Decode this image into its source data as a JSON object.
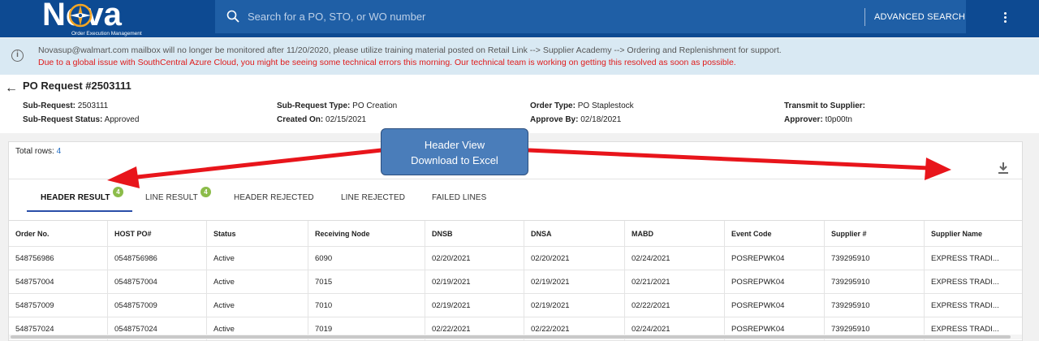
{
  "app": {
    "logo_word": "Nova",
    "tagline": "Order Execution Management"
  },
  "search": {
    "placeholder": "Search for a PO, STO, or WO number",
    "advanced_label": "ADVANCED SEARCH"
  },
  "banner": {
    "message": "Novasup@walmart.com mailbox will no longer be monitored after 11/20/2020, please utilize training material posted on Retail Link --> Supplier Academy --> Ordering and Replenishment for support.",
    "alert": "Due to a global issue with SouthCentral Azure Cloud, you might be seeing some technical errors this morning. Our technical team is working on getting this resolved as soon as possible."
  },
  "request": {
    "title": "PO Request #2503111",
    "fields": [
      {
        "label": "Sub-Request:",
        "value": "2503111"
      },
      {
        "label": "Sub-Request Status:",
        "value": "Approved"
      },
      {
        "label": "Sub-Request Type:",
        "value": "PO Creation"
      },
      {
        "label": "Created On:",
        "value": "02/15/2021"
      },
      {
        "label": "Order Type:",
        "value": "PO Staplestock"
      },
      {
        "label": "Approve By:",
        "value": "02/18/2021"
      },
      {
        "label": "Transmit to Supplier:",
        "value": ""
      },
      {
        "label": "Approver:",
        "value": "t0p00tn"
      }
    ]
  },
  "results": {
    "total_label": "Total rows:",
    "total_value": "4",
    "tabs": [
      {
        "label": "HEADER RESULT",
        "badge": "4"
      },
      {
        "label": "LINE RESULT",
        "badge": "4"
      },
      {
        "label": "HEADER REJECTED",
        "badge": ""
      },
      {
        "label": "LINE REJECTED",
        "badge": ""
      },
      {
        "label": "FAILED LINES",
        "badge": ""
      }
    ],
    "columns": [
      "Order No.",
      "HOST PO#",
      "Status",
      "Receiving Node",
      "DNSB",
      "DNSA",
      "MABD",
      "Event Code",
      "Supplier #",
      "Supplier Name"
    ],
    "rows": [
      [
        "548756986",
        "0548756986",
        "Active",
        "6090",
        "02/20/2021",
        "02/20/2021",
        "02/24/2021",
        "POSREPWK04",
        "739295910",
        "EXPRESS TRADI..."
      ],
      [
        "548757004",
        "0548757004",
        "Active",
        "7015",
        "02/19/2021",
        "02/19/2021",
        "02/21/2021",
        "POSREPWK04",
        "739295910",
        "EXPRESS TRADI..."
      ],
      [
        "548757009",
        "0548757009",
        "Active",
        "7010",
        "02/19/2021",
        "02/19/2021",
        "02/22/2021",
        "POSREPWK04",
        "739295910",
        "EXPRESS TRADI..."
      ],
      [
        "548757024",
        "0548757024",
        "Active",
        "7019",
        "02/22/2021",
        "02/22/2021",
        "02/24/2021",
        "POSREPWK04",
        "739295910",
        "EXPRESS TRADI..."
      ]
    ]
  },
  "annotation": {
    "line1": "Header View",
    "line2": "Download to Excel"
  },
  "icons": {
    "search": "search-icon",
    "menu": "more-vertical-icon",
    "info": "info-icon",
    "back": "arrow-left-icon",
    "download": "download-icon"
  },
  "colors": {
    "header_bg": "#0d4a92",
    "banner_bg": "#d9e9f3",
    "alert_text": "#e01b1b",
    "badge": "#8cbc4a",
    "tab_underline": "#2a4ea8",
    "annotation_arrow": "#e8151b"
  }
}
